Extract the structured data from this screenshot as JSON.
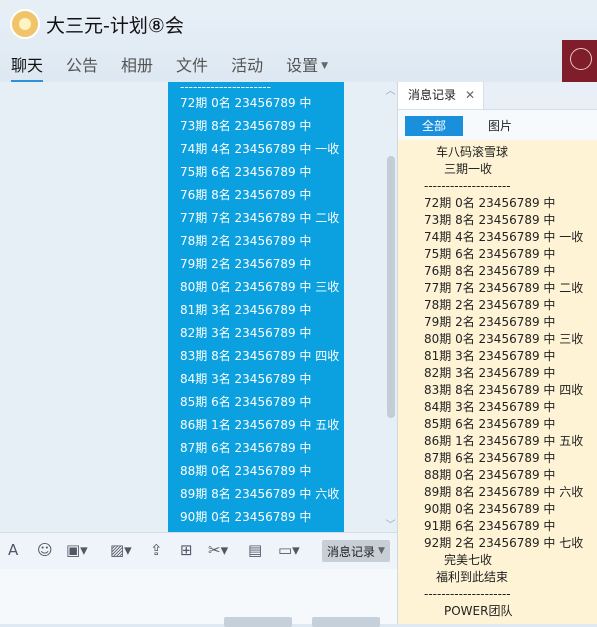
{
  "window": {
    "title": "大三元-计划⑧会"
  },
  "nav": {
    "tabs": [
      {
        "label": "聊天"
      },
      {
        "label": "公告"
      },
      {
        "label": "相册"
      },
      {
        "label": "文件"
      },
      {
        "label": "活动"
      },
      {
        "label": "设置"
      }
    ]
  },
  "chat": {
    "separator": "---------------------",
    "lines": [
      "72期 0名 23456789 中",
      "73期 8名 23456789 中",
      "74期 4名 23456789 中 一收",
      "75期 6名 23456789 中",
      "76期 8名 23456789 中",
      "77期 7名 23456789 中 二收",
      "78期 2名 23456789 中",
      "79期 2名 23456789 中",
      "80期 0名 23456789 中 三收",
      "81期 3名 23456789 中",
      "82期 3名 23456789 中",
      "83期 8名 23456789 中 四收",
      "84期 3名 23456789 中",
      "85期 6名 23456789 中",
      "86期 1名 23456789 中 五收",
      "87期 6名 23456789 中",
      "88期 0名 23456789 中",
      "89期 8名 23456789 中 六收",
      "90期 0名 23456789 中"
    ]
  },
  "toolbar": {
    "history_label": "消息记录"
  },
  "history": {
    "tab_label": "消息记录",
    "filter_all": "全部",
    "filter_images": "图片",
    "header1": "车八码滚雪球",
    "header2": "三期一收",
    "separator": "--------------------",
    "lines": [
      "72期 0名 23456789 中",
      "73期 8名 23456789 中",
      "74期 4名 23456789 中 一收",
      "75期 6名 23456789 中",
      "76期 8名 23456789 中",
      "77期 7名 23456789 中 二收",
      "78期 2名 23456789 中",
      "79期 2名 23456789 中",
      "80期 0名 23456789 中 三收",
      "81期 3名 23456789 中",
      "82期 3名 23456789 中",
      "83期 8名 23456789 中 四收",
      "84期 3名 23456789 中",
      "85期 6名 23456789 中",
      "86期 1名 23456789 中 五收",
      "87期 6名 23456789 中",
      "88期 0名 23456789 中",
      "89期 8名 23456789 中 六收",
      "90期 0名 23456789 中",
      "91期 6名 23456789 中",
      "92期 2名 23456789 中 七收"
    ],
    "footer1": "完美七收",
    "footer2": "福利到此结束",
    "footer_sep": "--------------------",
    "signature": "POWER团队"
  },
  "icons": {
    "font": "font-icon",
    "emoji": "emoji-icon",
    "screenshot": "screenshot-icon",
    "image": "image-icon",
    "upload": "upload-icon",
    "gift": "gift-icon",
    "scissors": "scissors-icon",
    "red_packet": "red-packet-icon",
    "chat_bubble": "chat-bubble-icon"
  }
}
